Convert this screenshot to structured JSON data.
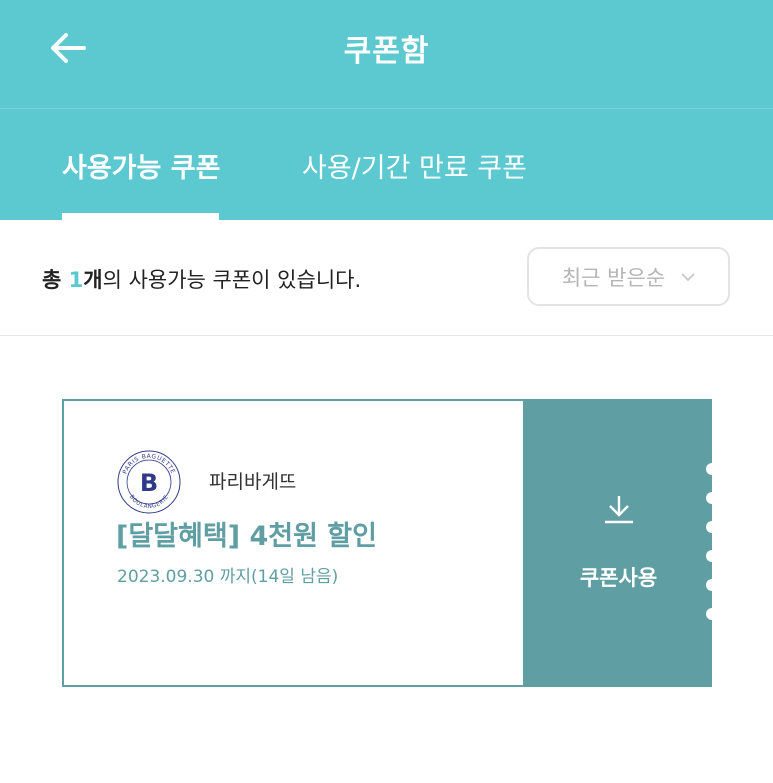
{
  "header": {
    "title": "쿠폰함",
    "back_icon": "arrow-left-icon",
    "background": "#5cc8cf"
  },
  "tabs": [
    {
      "label": "사용가능 쿠폰",
      "active": true
    },
    {
      "label": "사용/기간 만료 쿠폰",
      "active": false
    }
  ],
  "summary": {
    "prefix": "총 ",
    "count": "1",
    "unit": "개",
    "suffix": "의 사용가능 쿠폰이 있습니다."
  },
  "sort": {
    "selected": "최근 받은순",
    "icon": "chevron-down-icon"
  },
  "coupon": {
    "brand_logo_text_top": "PARIS BAGUETTE",
    "brand_logo_text_bottom": "BOULANGERIE",
    "brand_logo_letter": "B",
    "brand_name": "파리바게뜨",
    "title": "[달달혜택] 4천원 할인",
    "expiry": "2023.09.30 까지(14일 남음)",
    "use_label": "쿠폰사용",
    "use_icon": "download-icon",
    "accent": "#5f9ea3"
  }
}
